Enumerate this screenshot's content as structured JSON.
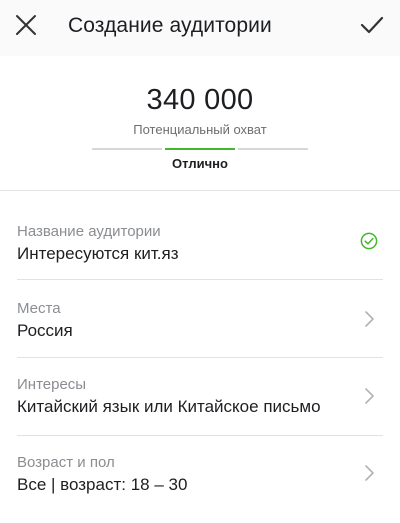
{
  "header": {
    "title": "Создание аудитории",
    "close_icon": "close-icon",
    "done_icon": "checkmark-icon"
  },
  "reach": {
    "number": "340 000",
    "caption": "Потенциальный охват",
    "rating": "Отлично",
    "meter_active_segment": 2,
    "meter_segments": 3,
    "accent_color": "#42b72a"
  },
  "fields": [
    {
      "label": "Название аудитории",
      "value": "Интересуются кит.яз",
      "trail_icon": "check-circle-icon"
    },
    {
      "label": "Места",
      "value": "Россия",
      "trail_icon": "chevron-right-icon"
    },
    {
      "label": "Интересы",
      "value": "Китайский язык или Китайское письмо",
      "trail_icon": "chevron-right-icon"
    },
    {
      "label": "Возраст и пол",
      "value": "Все | возраст: 18 – 30",
      "trail_icon": "chevron-right-icon"
    }
  ]
}
